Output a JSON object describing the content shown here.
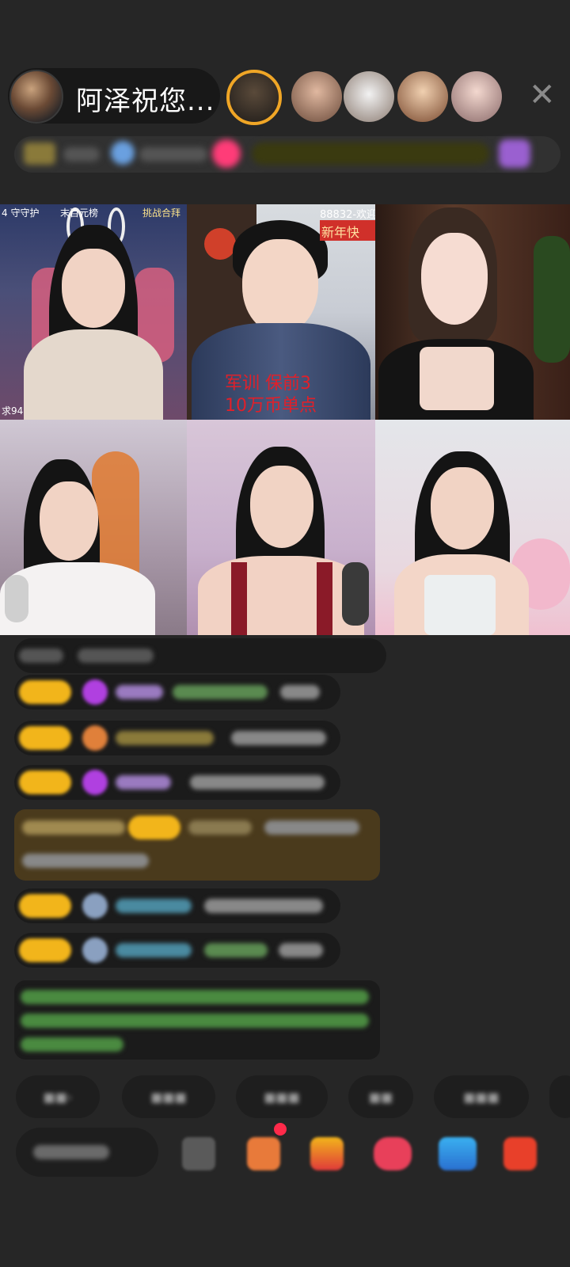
{
  "header": {
    "host_name": "阿泽祝您...",
    "close_label": "✕",
    "viewers_count": 5
  },
  "grid": {
    "tile1": {
      "top_left": "4 守守护",
      "top_mid": "末百元榜",
      "top_right": "挑战合拜",
      "bottom_left": "求94"
    },
    "tile2": {
      "top_right": "88832-欢迎",
      "banner": "新年快",
      "caption_line1": "军训 保前3",
      "caption_line2": "10万币单点"
    }
  },
  "chat": {
    "input_placeholder": "说点什么"
  },
  "colors": {
    "background": "#262626",
    "level_badge": "#f2b51b",
    "accent_red": "#e0202a",
    "gift_row": "#5a4420"
  }
}
